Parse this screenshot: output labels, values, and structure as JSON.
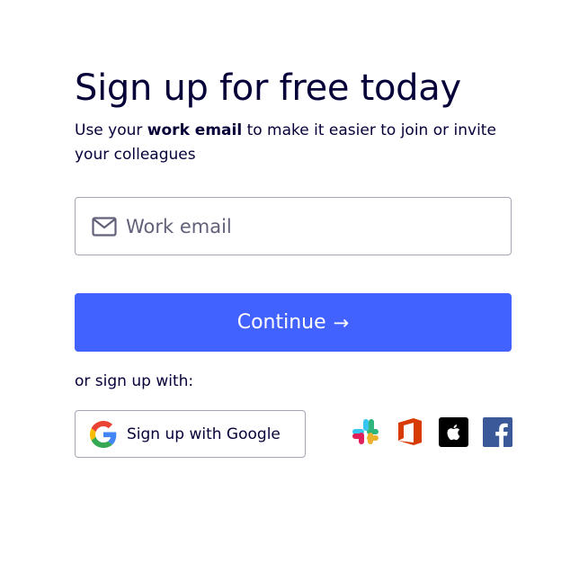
{
  "header": {
    "title": "Sign up for free today",
    "subtitle_prefix": "Use your ",
    "subtitle_bold": "work email",
    "subtitle_suffix": " to make it easier to join or invite your colleagues"
  },
  "email": {
    "placeholder": "Work email",
    "value": "",
    "icon": "mail-icon"
  },
  "continue": {
    "label": "Continue",
    "arrow": "→",
    "color": "#4262ff"
  },
  "alternatives": {
    "label": "or sign up with:",
    "google_label": "Sign up with Google",
    "providers": [
      {
        "name": "Slack",
        "icon": "slack-icon"
      },
      {
        "name": "Office 365",
        "icon": "office-icon"
      },
      {
        "name": "Apple",
        "icon": "apple-icon"
      },
      {
        "name": "Facebook",
        "icon": "facebook-icon"
      }
    ]
  },
  "colors": {
    "text": "#050038",
    "accent": "#4262ff",
    "border": "#a5a5b8",
    "office": "#d83b01",
    "facebook": "#3b5998",
    "apple_bg": "#000000"
  }
}
